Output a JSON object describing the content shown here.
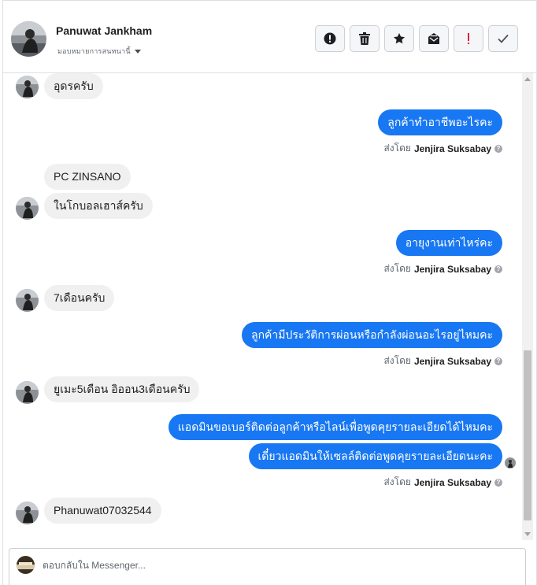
{
  "header": {
    "contact_name": "Panuwat Jankham",
    "assign_label": "มอบหมายการสนทนานี้"
  },
  "actions": [
    {
      "name": "info-button",
      "icon": "alert-circle-icon"
    },
    {
      "name": "delete-button",
      "icon": "trash-icon"
    },
    {
      "name": "star-button",
      "icon": "star-icon"
    },
    {
      "name": "mark-unread-button",
      "icon": "envelope-icon"
    },
    {
      "name": "spam-button",
      "icon": "exclamation-icon"
    },
    {
      "name": "done-button",
      "icon": "checkmark-icon"
    }
  ],
  "messages": [
    {
      "dir": "in",
      "text": "อุดรครับ"
    },
    {
      "dir": "out",
      "text": "ลูกค้าทำอาชีพอะไรคะ"
    },
    {
      "dir": "in",
      "text": "PC ZINSANO"
    },
    {
      "dir": "in",
      "text": "ในโกบอลเฮาส์ครับ"
    },
    {
      "dir": "out",
      "text": "อายุงานเท่าไหร่คะ"
    },
    {
      "dir": "in",
      "text": "7เดือนครับ"
    },
    {
      "dir": "out",
      "text": "ลูกค้ามีประวัติการผ่อนหรือกำลังผ่อนอะไรอยู่ไหมคะ"
    },
    {
      "dir": "in",
      "text": "ยูเมะ5เดือน อิออน3เดือนครับ"
    },
    {
      "dir": "out",
      "text": "แอดมินขอเบอร์ติดต่อลูกค้าหรือไลน์เพื่อพูดคุยรายละเอียดได้ไหมคะ"
    },
    {
      "dir": "out",
      "text": "เดี๋ยวแอดมินให้เซลล์ติดต่อพูดคุยรายละเอียดนะคะ"
    },
    {
      "dir": "in",
      "text": "Phanuwat07032544"
    }
  ],
  "sent_by": {
    "prefix": "ส่งโดย",
    "agent": "Jenjira Suksabay"
  },
  "reply": {
    "placeholder": "ตอบกลับใน Messenger..."
  },
  "colors": {
    "outgoing_bubble": "#1877f2",
    "incoming_bubble": "#f0f0f0",
    "spam_icon": "#e41e3f"
  }
}
